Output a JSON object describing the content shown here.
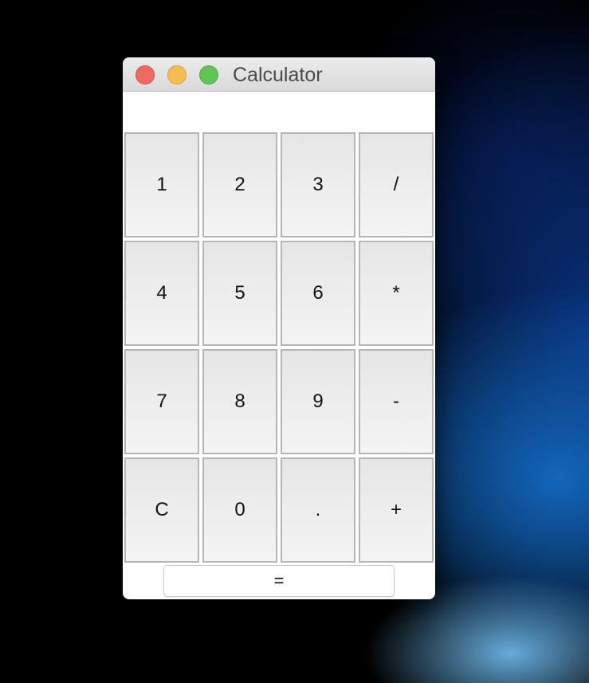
{
  "window": {
    "title": "Calculator",
    "controls": {
      "close": "close-window",
      "minimize": "minimize-window",
      "zoom": "zoom-window"
    },
    "colors": {
      "close": "#ee6a5f",
      "minimize": "#f5bd4f",
      "zoom": "#61c554"
    }
  },
  "display": {
    "value": ""
  },
  "keys": [
    [
      "1",
      "2",
      "3",
      "/"
    ],
    [
      "4",
      "5",
      "6",
      "*"
    ],
    [
      "7",
      "8",
      "9",
      "-"
    ],
    [
      "C",
      "0",
      ".",
      "+"
    ]
  ],
  "equals_label": "="
}
